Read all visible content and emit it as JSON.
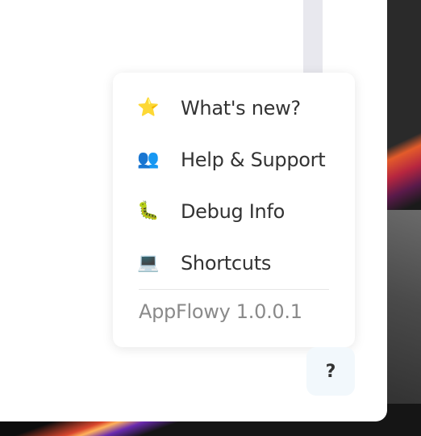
{
  "menu": {
    "items": [
      {
        "icon": "⭐",
        "icon_name": "star-icon",
        "label": "What's new?"
      },
      {
        "icon": "👥",
        "icon_name": "people-icon",
        "label": "Help & Support"
      },
      {
        "icon": "🐛",
        "icon_name": "bug-icon",
        "label": "Debug Info"
      },
      {
        "icon": "💻",
        "icon_name": "laptop-icon",
        "label": "Shortcuts"
      }
    ],
    "version": "AppFlowy 1.0.0.1"
  },
  "help_button": {
    "label": "?"
  },
  "colors": {
    "popup_bg": "#ffffff",
    "text": "#333333",
    "muted_text": "#8a8a8a",
    "help_button_bg": "#f2f8fc"
  }
}
